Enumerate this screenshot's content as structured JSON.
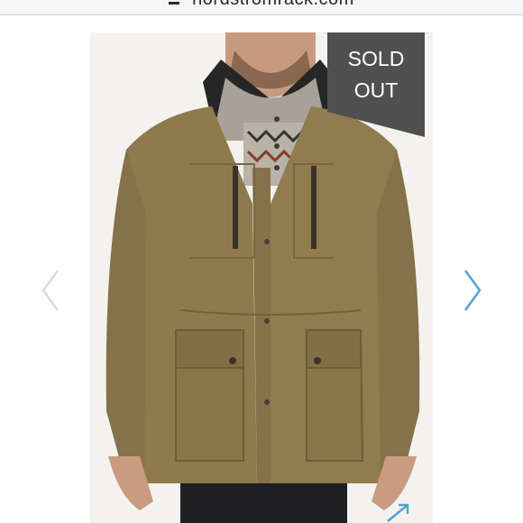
{
  "browser": {
    "url": "nordstromrack.com"
  },
  "product": {
    "badge": [
      "SOLD",
      "OUT"
    ]
  },
  "carousel": {
    "prev_icon": "chevron-left-icon",
    "next_icon": "chevron-right-icon",
    "expand_icon": "expand-icon",
    "arrow_color_prev": "#d4dde6",
    "arrow_color_next": "#5a9fd0"
  },
  "colors": {
    "badge_bg": "#505050",
    "jacket": "#8f7a4d"
  }
}
